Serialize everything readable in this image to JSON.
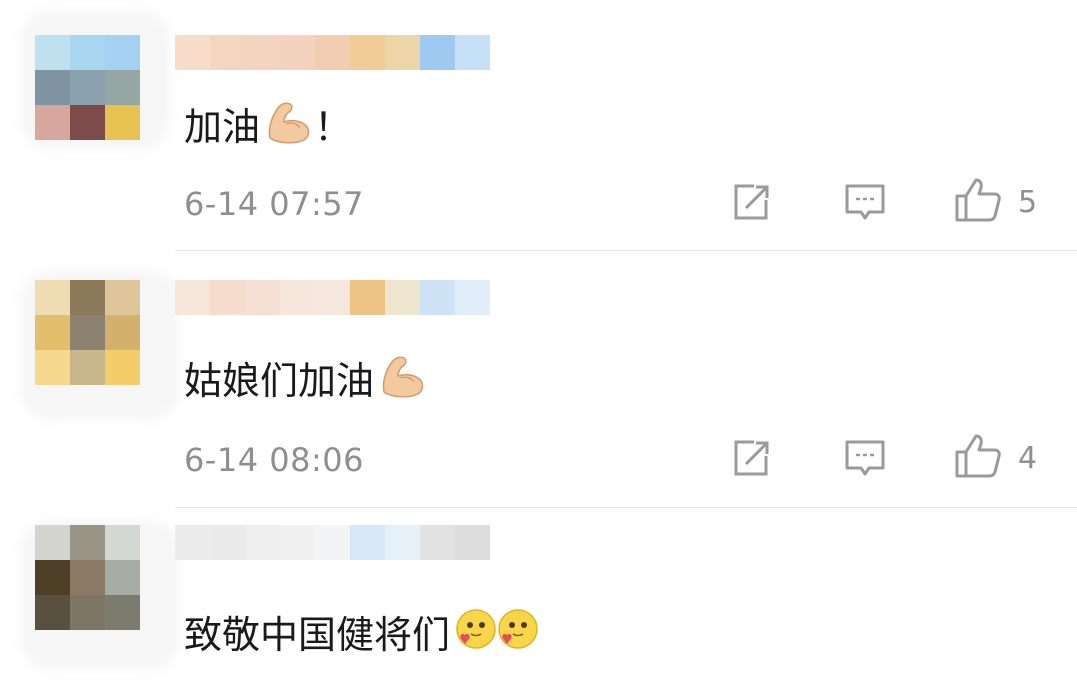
{
  "comments": [
    {
      "text": "加油",
      "text_suffix": "！",
      "emoji": "flexed-biceps",
      "time": "6-14 07:57",
      "likes": "5",
      "avatar_colors": [
        "#bfe0ee",
        "#a9d6f1",
        "#a5d2f2",
        "#7f93a0",
        "#8aa0ad",
        "#95a7a3",
        "#d7a79e",
        "#7d4b4b",
        "#e8c253"
      ],
      "name_colors": [
        "#f6dcc9",
        "#f4d5c0",
        "#f3d4c1",
        "#f3d3bf",
        "#f2cdb2",
        "#efcd95",
        "#ecd6a8",
        "#9ecaf2",
        "#c6e1f7"
      ]
    },
    {
      "text": "姑娘们加油",
      "text_suffix": "",
      "emoji": "flexed-biceps",
      "time": "6-14 08:06",
      "likes": "4",
      "avatar_colors": [
        "#efdcb3",
        "#8a7a5a",
        "#dcc69a",
        "#e2be6d",
        "#8d8172",
        "#d3b06c",
        "#f6d78e",
        "#c9b68a",
        "#f2cd6a"
      ],
      "name_colors": [
        "#f7e6da",
        "#f5dccd",
        "#f5e0d3",
        "#f6e6db",
        "#f6e8df",
        "#eec486",
        "#efe6cf",
        "#cfe3f6",
        "#e1eef9"
      ]
    },
    {
      "text": "致敬中国健将们",
      "text_suffix": "",
      "emoji": "blushing-face-with-heart",
      "time": "",
      "likes": "",
      "avatar_colors": [
        "#d3d3d0",
        "#9a9486",
        "#d4d8d4",
        "#4c3f26",
        "#8a7a64",
        "#a7aca4",
        "#5a5040",
        "#7d7665",
        "#7b7c6e"
      ],
      "name_colors": [
        "#ececec",
        "#eaeaea",
        "#eeeeee",
        "#f0f0f0",
        "#f2f4f6",
        "#d8e8f6",
        "#e6f0f8",
        "#e2e2e2",
        "#dddddd"
      ]
    }
  ],
  "icons": {
    "share": "share-icon",
    "reply": "comment-icon",
    "like": "thumbs-up-icon"
  },
  "colors": {
    "text": "#1a1a1a",
    "meta": "#8f8f8f",
    "divider": "#e6e6e6"
  }
}
